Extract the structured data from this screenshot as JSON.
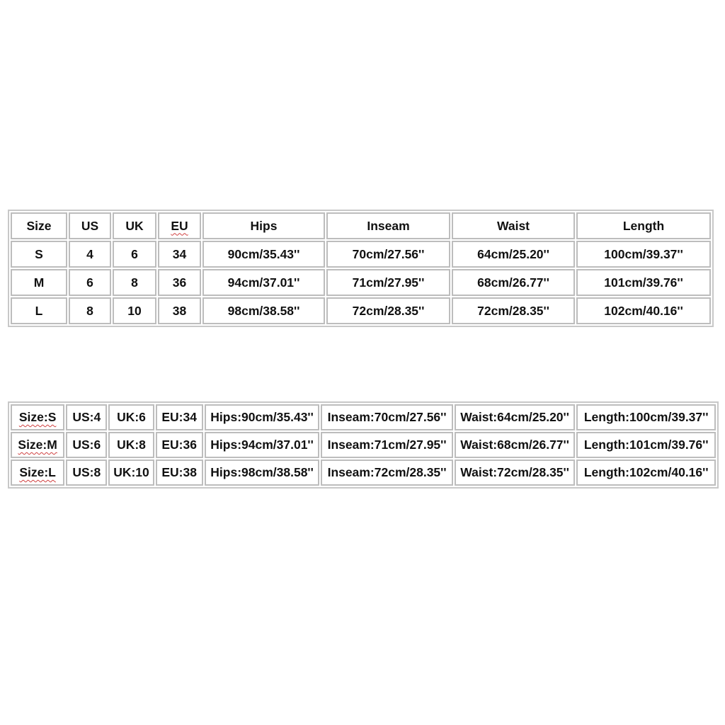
{
  "table1": {
    "headers": [
      "Size",
      "US",
      "UK",
      "EU",
      "Hips",
      "Inseam",
      "Waist",
      "Length"
    ],
    "rows": [
      [
        "S",
        "4",
        "6",
        "34",
        "90cm/35.43''",
        "70cm/27.56''",
        "64cm/25.20''",
        "100cm/39.37''"
      ],
      [
        "M",
        "6",
        "8",
        "36",
        "94cm/37.01''",
        "71cm/27.95''",
        "68cm/26.77''",
        "101cm/39.76''"
      ],
      [
        "L",
        "8",
        "10",
        "38",
        "98cm/38.58''",
        "72cm/28.35''",
        "72cm/28.35''",
        "102cm/40.16''"
      ]
    ]
  },
  "table2": {
    "rows": [
      [
        "Size:S",
        "US:4",
        "UK:6",
        "EU:34",
        "Hips:90cm/35.43''",
        "Inseam:70cm/27.56''",
        "Waist:64cm/25.20''",
        "Length:100cm/39.37''"
      ],
      [
        "Size:M",
        "US:6",
        "UK:8",
        "EU:36",
        "Hips:94cm/37.01''",
        "Inseam:71cm/27.95''",
        "Waist:68cm/26.77''",
        "Length:101cm/39.76''"
      ],
      [
        "Size:L",
        "US:8",
        "UK:10",
        "EU:38",
        "Hips:98cm/38.58''",
        "Inseam:72cm/28.35''",
        "Waist:72cm/28.35''",
        "Length:102cm/40.16''"
      ]
    ]
  },
  "colors": {
    "border": "#bdbdbd",
    "text": "#111111",
    "spellcheck_underline": "#d04040"
  }
}
